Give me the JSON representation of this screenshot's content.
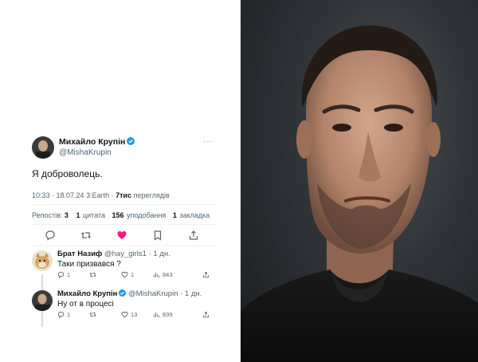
{
  "tweet": {
    "author_name": "Михайло Крупін",
    "author_handle": "@MishaKrupin",
    "more": "···",
    "text": "Я доброволець.",
    "time": "10:33 · 18.07.24",
    "source": "3:Earth",
    "views_count": "7тис",
    "views_label": "переглядів",
    "stats": {
      "reposts_label": "Репостів:",
      "reposts": "3",
      "quotes": "1",
      "quotes_label": "цитата",
      "likes": "156",
      "likes_label": "уподобання",
      "bookmarks": "1",
      "bookmarks_label": "закладка"
    }
  },
  "replies": [
    {
      "name": "Брат Назиф",
      "handle": "@hay_girls1",
      "time": "· 1 дн.",
      "text": "Таки призвався ?",
      "replies": "1",
      "reposts": "",
      "likes": "1",
      "views": "843"
    },
    {
      "name": "Михайло Крупін",
      "handle": "@MishaKrupin",
      "time": "· 1 дн.",
      "text": "Ну от в процесі",
      "replies": "1",
      "reposts": "",
      "likes": "13",
      "views": "839"
    }
  ],
  "colors": {
    "verified": "#1d9bf0",
    "like_active": "#f91880",
    "muted": "#536471"
  },
  "icons": [
    "verified-icon",
    "reply-icon",
    "retweet-icon",
    "like-icon",
    "bookmark-icon",
    "share-icon",
    "views-icon"
  ]
}
